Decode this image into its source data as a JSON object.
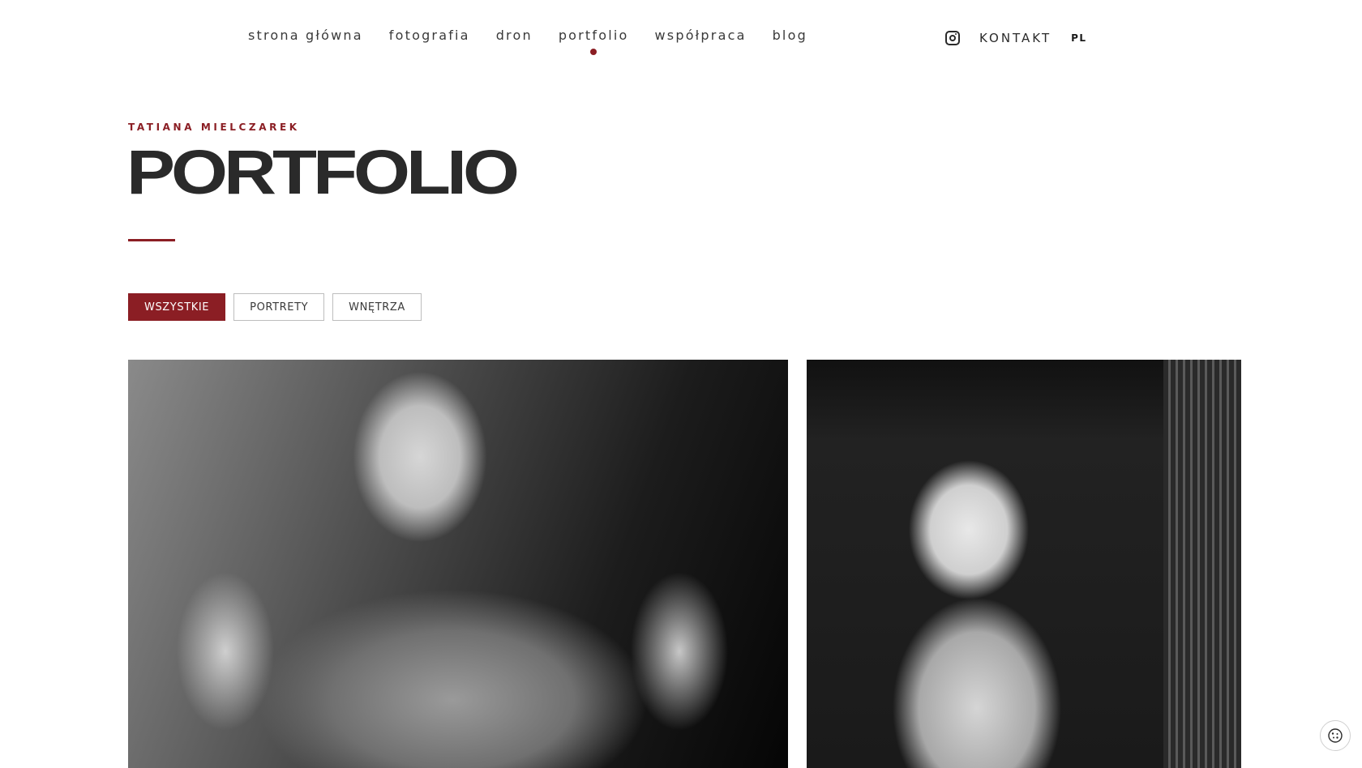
{
  "nav": {
    "items": [
      {
        "label": "strona główna"
      },
      {
        "label": "fotografia"
      },
      {
        "label": "dron"
      },
      {
        "label": "portfolio",
        "active": true
      },
      {
        "label": "współpraca"
      },
      {
        "label": "blog"
      }
    ],
    "instagram_icon": "instagram-icon",
    "contact_label": "KONTAKT",
    "language_label": "PL"
  },
  "hero": {
    "subtitle": "TATIANA MIELCZAREK",
    "title": "PORTFOLIO"
  },
  "filters": [
    {
      "label": "WSZYSTKIE",
      "active": true
    },
    {
      "label": "PORTRETY",
      "active": false
    },
    {
      "label": "WNĘTRZA",
      "active": false
    }
  ],
  "gallery": {
    "photos": [
      {
        "kind": "portrait-photo",
        "tone": "black-and-white"
      },
      {
        "kind": "portrait-photo",
        "tone": "black-and-white"
      }
    ]
  },
  "cookie": {
    "icon": "cookie-icon"
  },
  "colors": {
    "accent": "#8b1e24",
    "text": "#2a2a2a",
    "background": "#ffffff"
  }
}
